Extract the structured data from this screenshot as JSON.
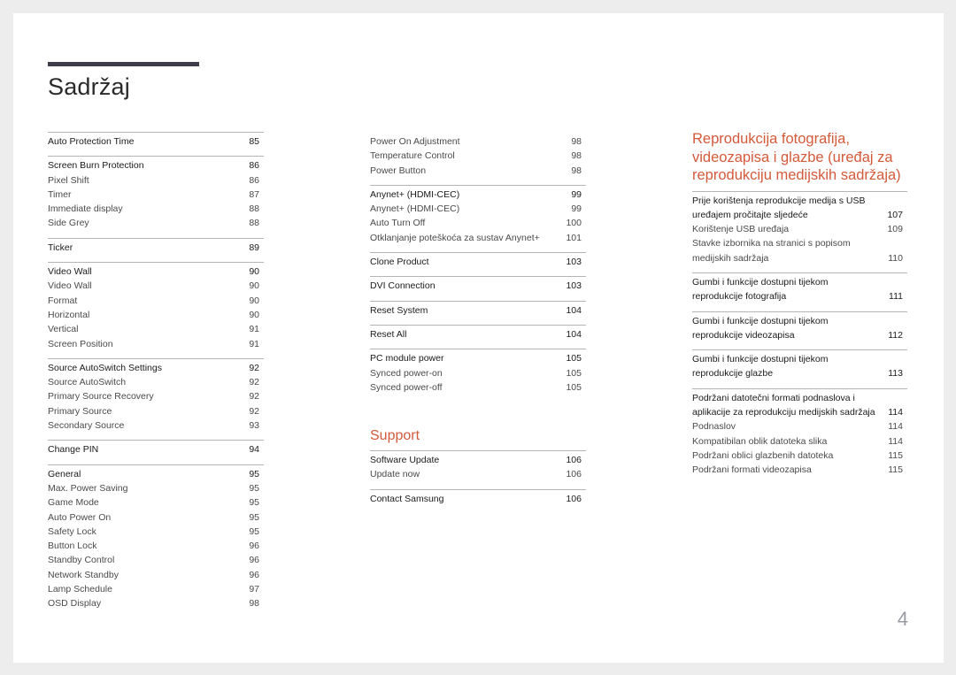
{
  "document": {
    "title": "Sadržaj",
    "page_number": "4"
  },
  "left_column": {
    "groups": [
      {
        "items": [
          {
            "label": "Auto Protection Time",
            "page": "85",
            "head": true
          }
        ]
      },
      {
        "items": [
          {
            "label": "Screen Burn Protection",
            "page": "86",
            "head": true
          },
          {
            "label": "Pixel Shift",
            "page": "86"
          },
          {
            "label": "Timer",
            "page": "87"
          },
          {
            "label": "Immediate display",
            "page": "88"
          },
          {
            "label": "Side Grey",
            "page": "88"
          }
        ]
      },
      {
        "items": [
          {
            "label": "Ticker",
            "page": "89",
            "head": true
          }
        ]
      },
      {
        "items": [
          {
            "label": "Video Wall",
            "page": "90",
            "head": true
          },
          {
            "label": "Video Wall",
            "page": "90"
          },
          {
            "label": "Format",
            "page": "90"
          },
          {
            "label": "Horizontal",
            "page": "90"
          },
          {
            "label": "Vertical",
            "page": "91"
          },
          {
            "label": "Screen Position",
            "page": "91"
          }
        ]
      },
      {
        "items": [
          {
            "label": "Source AutoSwitch Settings",
            "page": "92",
            "head": true
          },
          {
            "label": "Source AutoSwitch",
            "page": "92"
          },
          {
            "label": "Primary Source Recovery",
            "page": "92"
          },
          {
            "label": "Primary Source",
            "page": "92"
          },
          {
            "label": "Secondary Source",
            "page": "93"
          }
        ]
      },
      {
        "items": [
          {
            "label": "Change PIN",
            "page": "94",
            "head": true
          }
        ]
      },
      {
        "items": [
          {
            "label": "General",
            "page": "95",
            "head": true
          },
          {
            "label": "Max. Power Saving",
            "page": "95"
          },
          {
            "label": "Game Mode",
            "page": "95"
          },
          {
            "label": "Auto Power On",
            "page": "95"
          },
          {
            "label": "Safety Lock",
            "page": "95"
          },
          {
            "label": "Button Lock",
            "page": "96"
          },
          {
            "label": "Standby Control",
            "page": "96"
          },
          {
            "label": "Network Standby",
            "page": "96"
          },
          {
            "label": "Lamp Schedule",
            "page": "97"
          },
          {
            "label": "OSD Display",
            "page": "98"
          }
        ]
      }
    ]
  },
  "middle_column": {
    "groups": [
      {
        "items": [
          {
            "label": "Power On Adjustment",
            "page": "98"
          },
          {
            "label": "Temperature Control",
            "page": "98"
          },
          {
            "label": "Power Button",
            "page": "98"
          }
        ]
      },
      {
        "items": [
          {
            "label": "Anynet+ (HDMI-CEC)",
            "page": "99",
            "head": true
          },
          {
            "label": "Anynet+ (HDMI-CEC)",
            "page": "99"
          },
          {
            "label": "Auto Turn Off",
            "page": "100"
          },
          {
            "label": "Otklanjanje poteškoća za sustav Anynet+",
            "page": "101"
          }
        ]
      },
      {
        "items": [
          {
            "label": "Clone Product",
            "page": "103",
            "head": true
          }
        ]
      },
      {
        "items": [
          {
            "label": "DVI Connection",
            "page": "103",
            "head": true
          }
        ]
      },
      {
        "items": [
          {
            "label": "Reset System",
            "page": "104",
            "head": true
          }
        ]
      },
      {
        "items": [
          {
            "label": "Reset All",
            "page": "104",
            "head": true
          }
        ]
      },
      {
        "items": [
          {
            "label": "PC module power",
            "page": "105",
            "head": true
          },
          {
            "label": "Synced power-on",
            "page": "105"
          },
          {
            "label": "Synced power-off",
            "page": "105"
          }
        ]
      }
    ],
    "support": {
      "title": "Support",
      "groups": [
        {
          "items": [
            {
              "label": "Software Update",
              "page": "106",
              "head": true
            },
            {
              "label": "Update now",
              "page": "106"
            }
          ]
        },
        {
          "items": [
            {
              "label": "Contact Samsung",
              "page": "106",
              "head": true
            }
          ]
        }
      ]
    }
  },
  "right_column": {
    "title": "Reprodukcija fotografija, videozapisa i glazbe (uređaj za reprodukciju medijskih sadržaja)",
    "groups": [
      {
        "items": [
          {
            "label": "Prije korištenja reprodukcije medija s USB uređajem pročitajte sljedeće",
            "page": "107",
            "head": true
          },
          {
            "label": "Korištenje USB uređaja",
            "page": "109"
          },
          {
            "label": "Stavke izbornika na stranici s popisom medijskih sadržaja",
            "page": "110"
          }
        ]
      },
      {
        "items": [
          {
            "label": "Gumbi i funkcije dostupni tijekom reprodukcije fotografija",
            "page": "111",
            "head": true
          }
        ]
      },
      {
        "items": [
          {
            "label": "Gumbi i funkcije dostupni tijekom reprodukcije videozapisa",
            "page": "112",
            "head": true
          }
        ]
      },
      {
        "items": [
          {
            "label": "Gumbi i funkcije dostupni tijekom reprodukcije glazbe",
            "page": "113",
            "head": true
          }
        ]
      },
      {
        "items": [
          {
            "label": "Podržani datotečni formati podnaslova i aplikacije za reprodukciju medijskih sadržaja",
            "page": "114",
            "head": true
          },
          {
            "label": "Podnaslov",
            "page": "114"
          },
          {
            "label": "Kompatibilan oblik datoteka slika",
            "page": "114"
          },
          {
            "label": "Podržani oblici glazbenih datoteka",
            "page": "115"
          },
          {
            "label": "Podržani formati videozapisa",
            "page": "115"
          }
        ]
      }
    ]
  },
  "colors": {
    "accent": "#d35a3a",
    "title_bar": "#3f3d4a",
    "background": "#ededed",
    "page": "#ffffff"
  }
}
